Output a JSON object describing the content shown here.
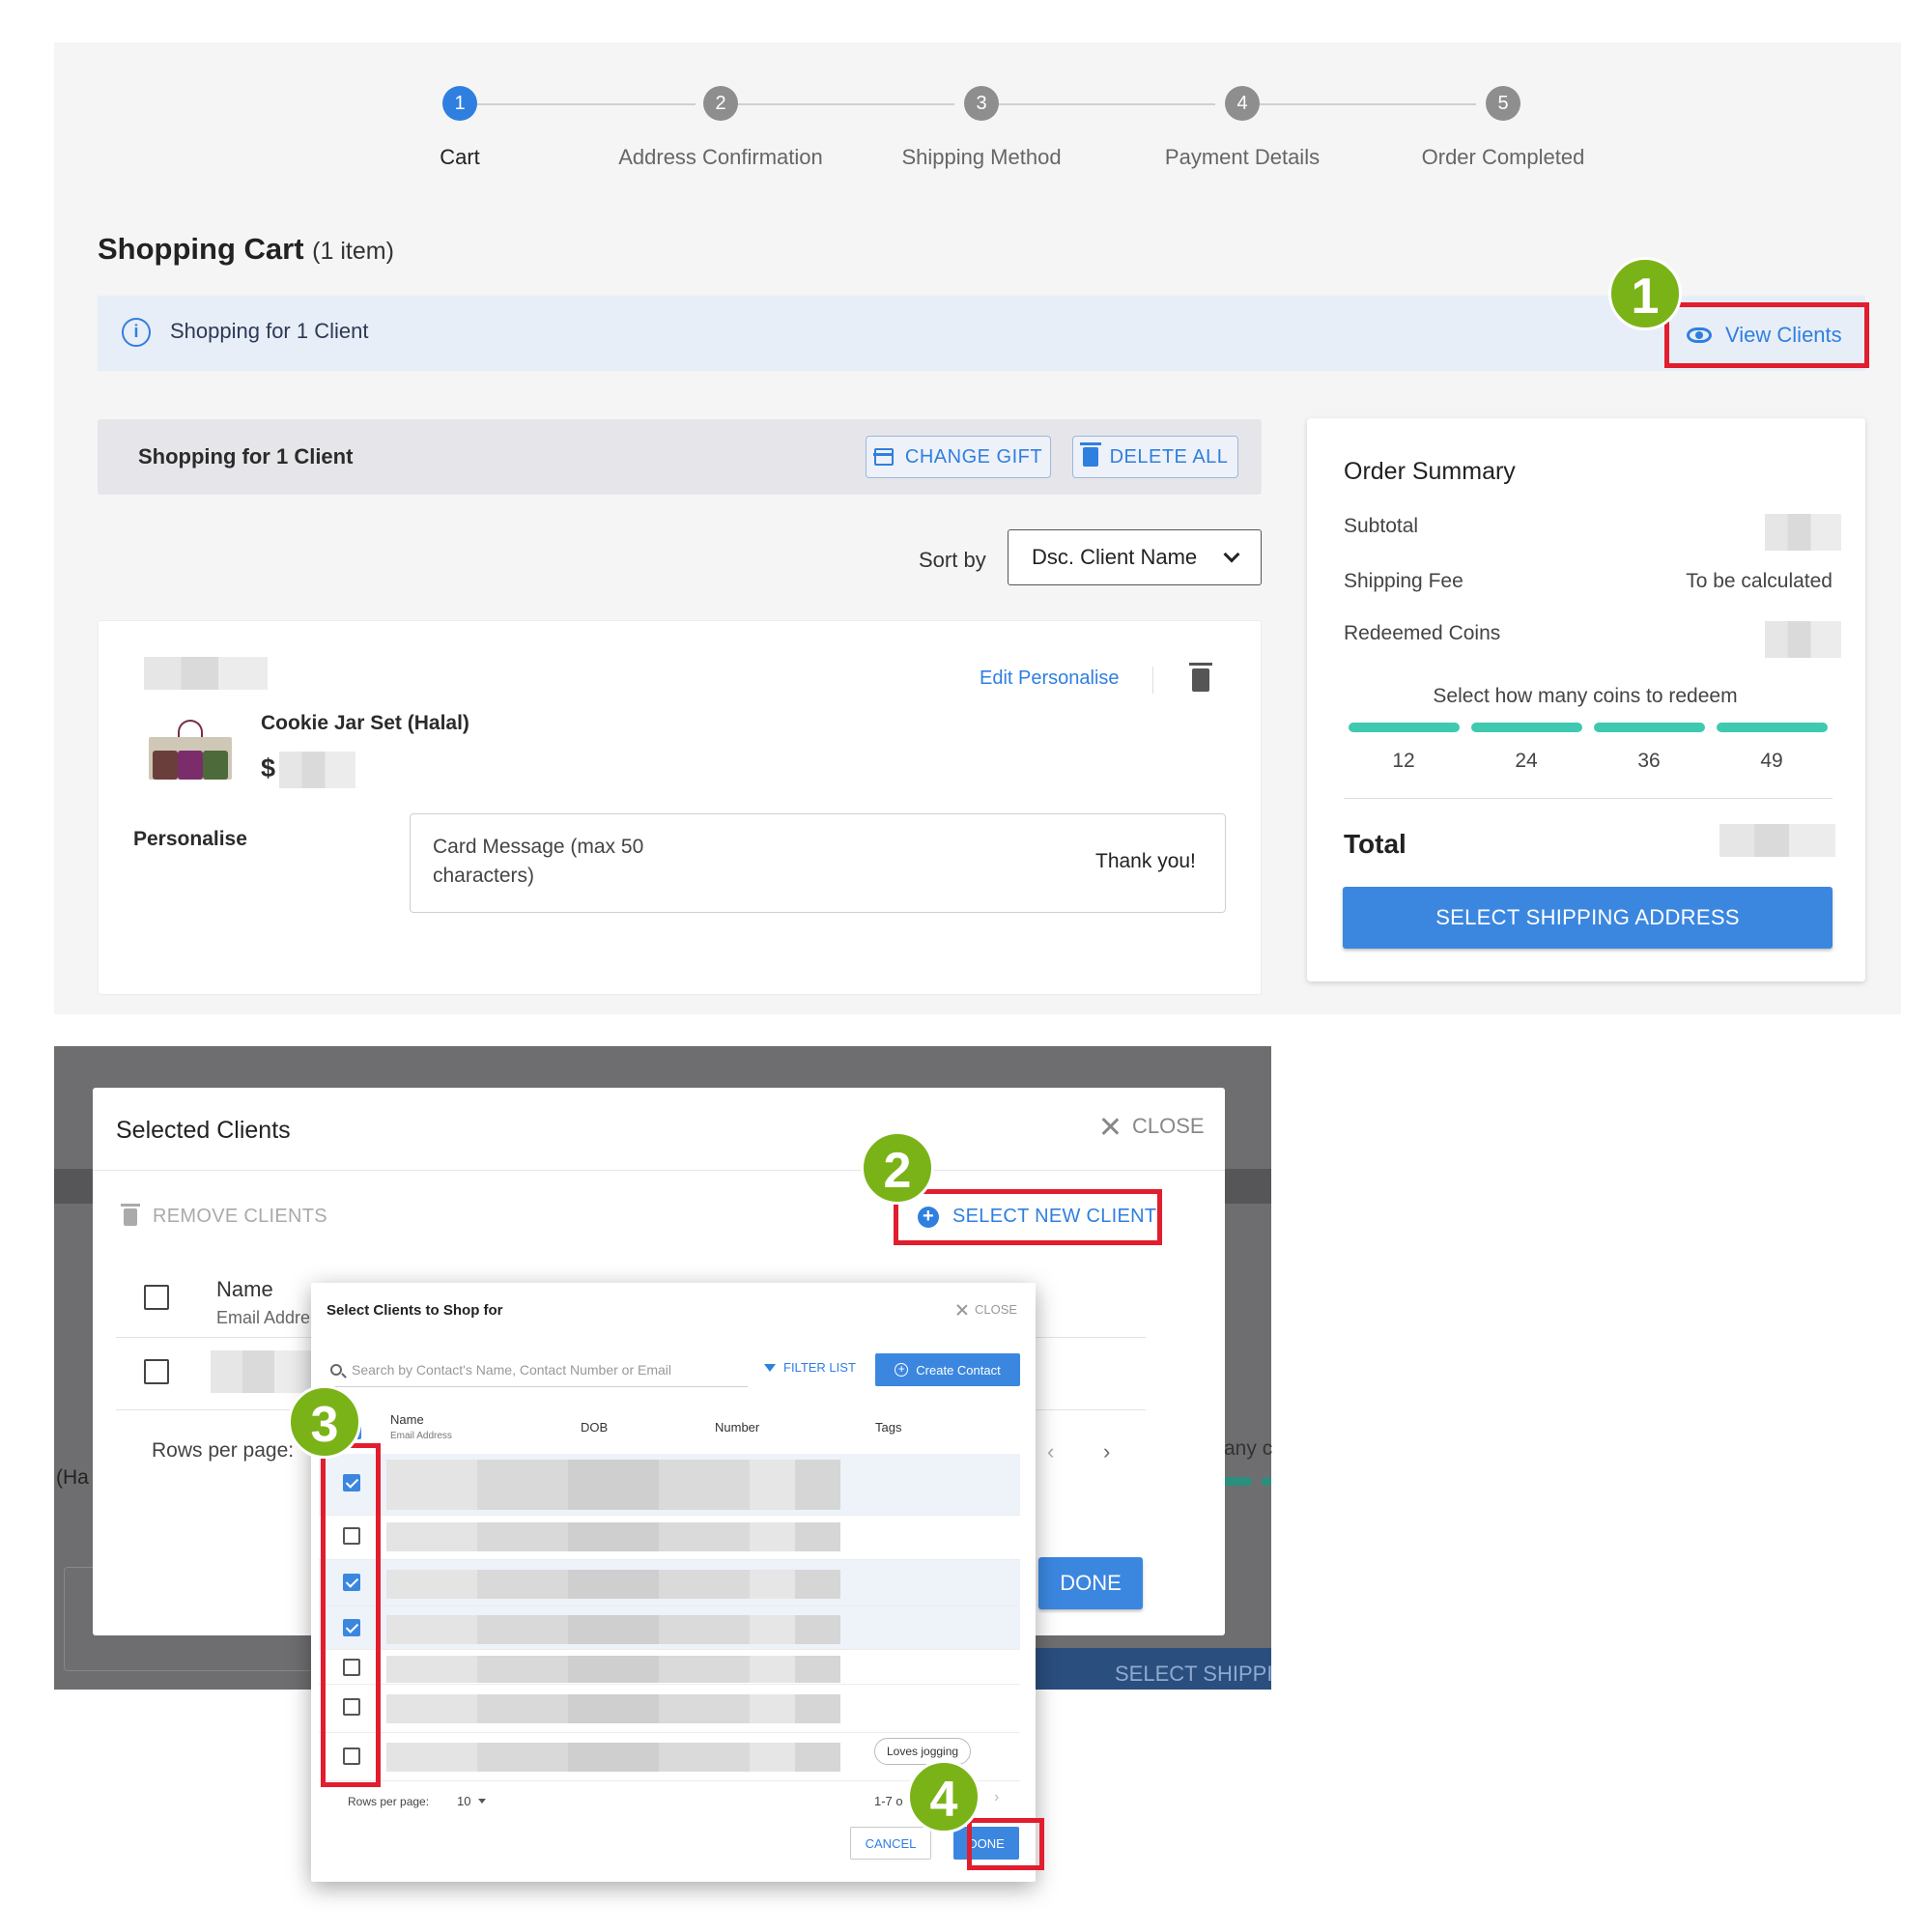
{
  "stepper": {
    "steps": [
      {
        "num": "1",
        "label": "Cart"
      },
      {
        "num": "2",
        "label": "Address Confirmation"
      },
      {
        "num": "3",
        "label": "Shipping Method"
      },
      {
        "num": "4",
        "label": "Payment Details"
      },
      {
        "num": "5",
        "label": "Order Completed"
      }
    ]
  },
  "cart": {
    "title": "Shopping Cart",
    "count": "(1 item)",
    "info_text": "Shopping for 1 Client",
    "view_clients": "View Clients",
    "group_label": "Shopping for 1 Client",
    "change_gift": "CHANGE GIFT",
    "delete_all": "DELETE ALL",
    "sort_label": "Sort by",
    "sort_value": "Dsc. Client Name",
    "item": {
      "name": "Cookie Jar Set (Halal)",
      "price_symbol": "$",
      "edit": "Edit Personalise",
      "personalise_label": "Personalise",
      "card_message_label": "Card Message (max 50 characters)",
      "card_message_value": "Thank you!"
    }
  },
  "order_summary": {
    "title": "Order Summary",
    "subtotal": "Subtotal",
    "shipping_fee": "Shipping Fee",
    "shipping_value": "To be calculated",
    "redeemed_coins": "Redeemed Coins",
    "coins_hint": "Select how many coins to redeem",
    "coin_options": [
      "12",
      "24",
      "36",
      "49"
    ],
    "total": "Total",
    "cta": "SELECT SHIPPING ADDRESS"
  },
  "overlay": {
    "ha_fragment": "(Ha",
    "any_fragment": "any c",
    "select_shipping_fragment": "SELECT SHIPPIN"
  },
  "selected_clients_dialog": {
    "title": "Selected Clients",
    "close": "CLOSE",
    "remove_clients": "REMOVE CLIENTS",
    "select_new_client": "SELECT NEW CLIENT",
    "col_name": "Name",
    "col_email": "Email Addre",
    "rows_per_page": "Rows per page:",
    "done": "DONE"
  },
  "select_clients_dialog": {
    "title": "Select Clients to Shop for",
    "close": "CLOSE",
    "search_placeholder": "Search by Contact's Name, Contact Number or Email",
    "filter_list": "FILTER LIST",
    "create_contact": "Create Contact",
    "columns": {
      "name": "Name",
      "email": "Email Address",
      "dob": "DOB",
      "number": "Number",
      "tags": "Tags"
    },
    "tag": "Loves jogging",
    "rows_per_page": "Rows per page:",
    "rows_value": "10",
    "range": "1-7 o",
    "cancel": "CANCEL",
    "done": "DONE"
  },
  "callouts": [
    "1",
    "2",
    "3",
    "4"
  ],
  "colors": {
    "accent": "#2f7fe0",
    "callout_green": "#7ab317",
    "highlight_red": "#e11d2e",
    "coin_teal": "#3ec9b0"
  }
}
